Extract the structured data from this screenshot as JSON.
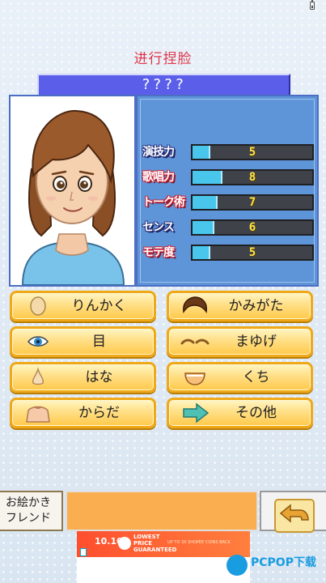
{
  "status_bar": {
    "battery_icon": "battery-icon"
  },
  "screen_title": "进行捏脸",
  "character_name": "????",
  "stats": [
    {
      "label": "演技力",
      "value": "5",
      "level": 0.15,
      "outline": "navy"
    },
    {
      "label": "歌唱力",
      "value": "8",
      "level": 0.25,
      "outline": "red"
    },
    {
      "label": "トーク術",
      "value": "7",
      "level": 0.21,
      "outline": "red"
    },
    {
      "label": "センス",
      "value": "6",
      "level": 0.18,
      "outline": "navy"
    },
    {
      "label": "モテ度",
      "value": "5",
      "level": 0.15,
      "outline": "red"
    }
  ],
  "menu": [
    {
      "label": "りんかく",
      "icon": "face-outline-icon"
    },
    {
      "label": "かみがた",
      "icon": "hairstyle-icon"
    },
    {
      "label": "目",
      "icon": "eye-icon"
    },
    {
      "label": "まゆげ",
      "icon": "eyebrow-icon"
    },
    {
      "label": "はな",
      "icon": "nose-icon"
    },
    {
      "label": "くち",
      "icon": "mouth-icon"
    },
    {
      "label": "からだ",
      "icon": "body-icon"
    },
    {
      "label": "その他",
      "icon": "arrow-right-icon"
    }
  ],
  "friend_panel": {
    "line1": "お絵かき",
    "line2": "フレンド"
  },
  "back_button": {
    "icon": "return-arrow-icon"
  },
  "ad": {
    "date": "10.10",
    "headline": "LOWEST PRICE GUARANTEED",
    "subline": "UP TO 3X SHOPEE COINS BACK"
  },
  "watermark": {
    "text": "PCPOP下载"
  },
  "colors": {
    "title_red": "#e0384b",
    "name_bar": "#5a5ee8",
    "stats_panel": "#5e94d8",
    "bar_fill": "#49c6ec",
    "button_gold": "#ffd566",
    "ad_orange": "#ff5a32"
  }
}
